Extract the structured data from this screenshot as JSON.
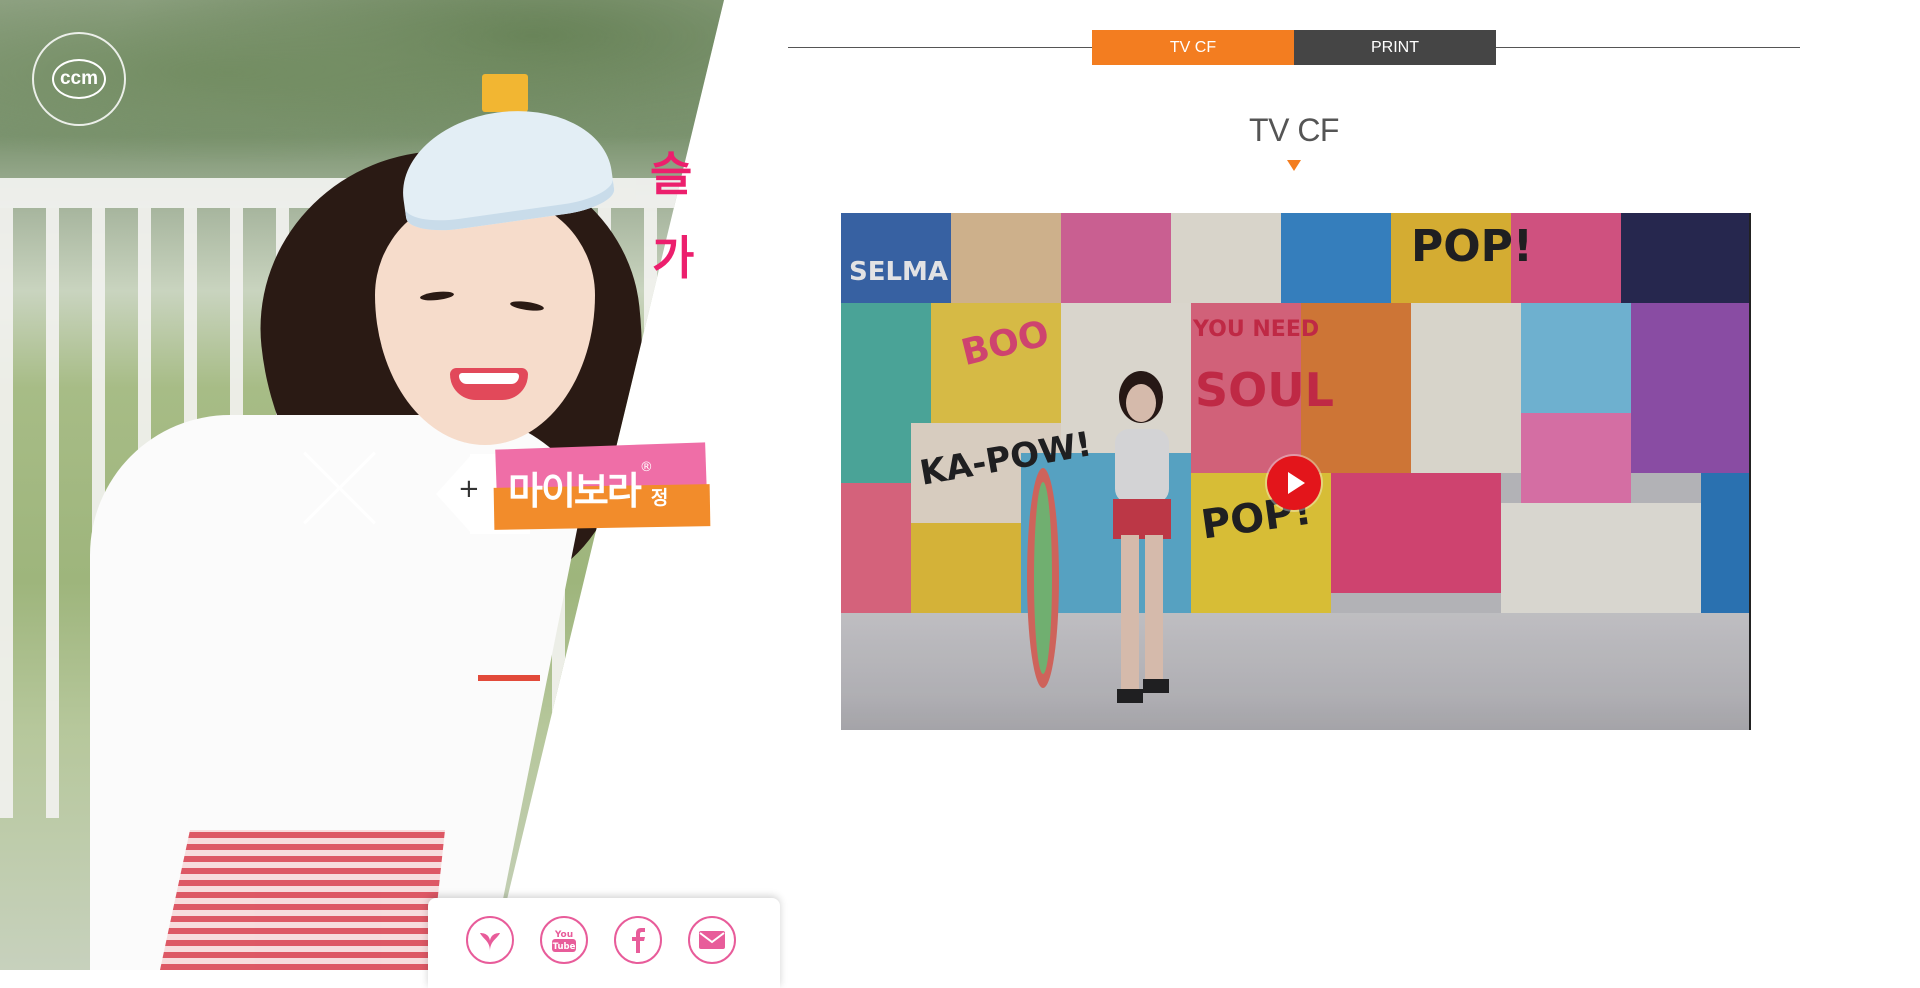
{
  "badge": {
    "text": "ccm"
  },
  "product": {
    "plus": "+",
    "name": "마이보라",
    "reg": "®",
    "suffix": "정"
  },
  "slogan": {
    "frag1": "슬",
    "frag2": "가"
  },
  "tabs": [
    {
      "label": "TV CF",
      "active": true
    },
    {
      "label": "PRINT",
      "active": false
    }
  ],
  "section": {
    "title": "TV CF"
  },
  "video": {
    "mural_texts": [
      "SELMA",
      "POP!",
      "YOU NEED",
      "SOUL",
      "KA-POW!",
      "POP!",
      "BOO"
    ]
  },
  "social": [
    {
      "name": "blog",
      "icon": "leaf-icon"
    },
    {
      "name": "youtube",
      "icon": "youtube-icon"
    },
    {
      "name": "facebook",
      "icon": "facebook-icon"
    },
    {
      "name": "email",
      "icon": "mail-icon"
    }
  ],
  "colors": {
    "accent": "#f37d20",
    "tab_inactive": "#454545",
    "brand_pink": "#ec1f6d",
    "social_pink": "#e85c9a",
    "play_red": "#e3151b"
  }
}
